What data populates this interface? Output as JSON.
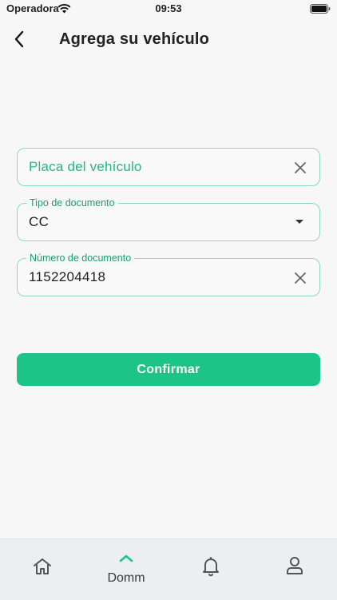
{
  "status_bar": {
    "carrier": "Operadora",
    "time": "09:53"
  },
  "header": {
    "title": "Agrega su vehículo"
  },
  "form": {
    "plate": {
      "placeholder": "Placa del vehículo",
      "value": ""
    },
    "doc_type": {
      "label": "Tipo de documento",
      "value": "CC"
    },
    "doc_number": {
      "label": "Número de documento",
      "value": "1152204418"
    }
  },
  "confirm_button": {
    "label": "Confirmar"
  },
  "tab_bar": {
    "tabs": [
      {
        "icon": "home-icon",
        "label": ""
      },
      {
        "icon": "chevron-up-icon",
        "label": "Domm",
        "active": true
      },
      {
        "icon": "bell-icon",
        "label": ""
      },
      {
        "icon": "user-icon",
        "label": ""
      }
    ]
  },
  "colors": {
    "accent": "#1dc487",
    "field_border": "#8ed9b9",
    "label": "#1d9c6c"
  }
}
